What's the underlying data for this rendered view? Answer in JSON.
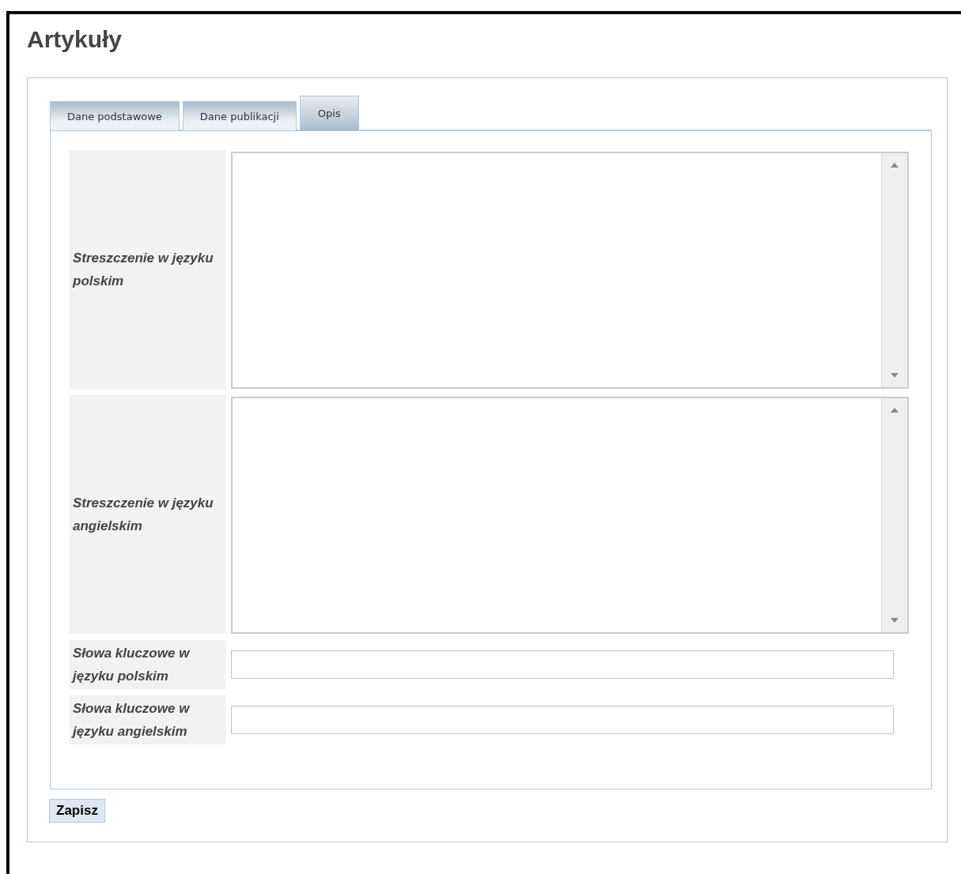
{
  "title": "Artykuły",
  "tabs": [
    {
      "label": "Dane podstawowe",
      "selected": false
    },
    {
      "label": "Dane publikacji",
      "selected": false
    },
    {
      "label": "Opis",
      "selected": true
    }
  ],
  "fields": [
    {
      "label": "Streszczenie w języku polskim",
      "kind": "textarea"
    },
    {
      "label": "Streszczenie w języku angielskim",
      "kind": "textarea"
    },
    {
      "label": "Słowa kluczowe w języku polskim",
      "kind": "text"
    },
    {
      "label": "Słowa kluczowe w języku angielskim",
      "kind": "text"
    }
  ],
  "save_button": "Zapisz"
}
